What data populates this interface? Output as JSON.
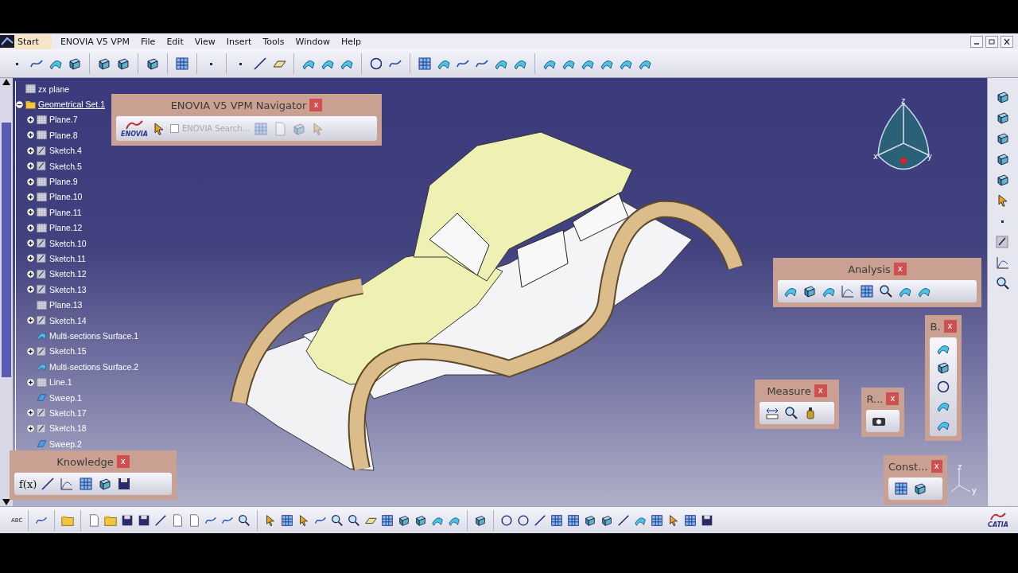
{
  "menu_bar": {
    "items": [
      {
        "label": "Start",
        "selected": true
      },
      {
        "label": "ENOVIA V5 VPM",
        "selected": false
      },
      {
        "label": "File",
        "selected": false
      },
      {
        "label": "Edit",
        "selected": false
      },
      {
        "label": "View",
        "selected": false
      },
      {
        "label": "Insert",
        "selected": false
      },
      {
        "label": "Tools",
        "selected": false
      },
      {
        "label": "Window",
        "selected": false
      },
      {
        "label": "Help",
        "selected": false
      }
    ]
  },
  "specification_tree": {
    "items": [
      {
        "label": "zx plane",
        "kind": "plane",
        "expandable": false
      },
      {
        "label": "Geometrical Set.1",
        "kind": "set",
        "expandable": true,
        "expanded": true,
        "children": [
          {
            "label": "Plane.7",
            "kind": "plane",
            "expandable": true,
            "expanded": false
          },
          {
            "label": "Plane.8",
            "kind": "plane",
            "expandable": true,
            "expanded": false
          },
          {
            "label": "Sketch.4",
            "kind": "sketch",
            "expandable": true,
            "expanded": false
          },
          {
            "label": "Sketch.5",
            "kind": "sketch",
            "expandable": true,
            "expanded": false
          },
          {
            "label": "Plane.9",
            "kind": "plane",
            "expandable": true,
            "expanded": false
          },
          {
            "label": "Plane.10",
            "kind": "plane",
            "expandable": true,
            "expanded": false
          },
          {
            "label": "Plane.11",
            "kind": "plane",
            "expandable": true,
            "expanded": false
          },
          {
            "label": "Plane.12",
            "kind": "plane",
            "expandable": true,
            "expanded": false
          },
          {
            "label": "Sketch.10",
            "kind": "sketch",
            "expandable": true,
            "expanded": false
          },
          {
            "label": "Sketch.11",
            "kind": "sketch",
            "expandable": true,
            "expanded": false
          },
          {
            "label": "Sketch.12",
            "kind": "sketch",
            "expandable": true,
            "expanded": false
          },
          {
            "label": "Sketch.13",
            "kind": "sketch",
            "expandable": true,
            "expanded": false
          },
          {
            "label": "Plane.13",
            "kind": "plane",
            "expandable": false
          },
          {
            "label": "Sketch.14",
            "kind": "sketch",
            "expandable": true,
            "expanded": false
          },
          {
            "label": "Multi-sections Surface.1",
            "kind": "surface",
            "expandable": false
          },
          {
            "label": "Sketch.15",
            "kind": "sketch",
            "expandable": true,
            "expanded": false
          },
          {
            "label": "Multi-sections Surface.2",
            "kind": "surface",
            "expandable": false
          },
          {
            "label": "Line.1",
            "kind": "plane",
            "expandable": true,
            "expanded": false
          },
          {
            "label": "Sweep.1",
            "kind": "sweep",
            "expandable": false
          },
          {
            "label": "Sketch.17",
            "kind": "sketch",
            "expandable": true,
            "expanded": false
          },
          {
            "label": "Sketch.18",
            "kind": "sketch",
            "expandable": true,
            "expanded": false
          },
          {
            "label": "Sweep.2",
            "kind": "sweep",
            "expandable": false
          }
        ]
      }
    ]
  },
  "floating_toolbars": [
    {
      "title": "ENOVIA V5 VPM Navigator",
      "close": "x",
      "kind": "enovia",
      "logo_text": "ENOVIA",
      "search": {
        "label": "ENOVIA Search...",
        "checked": false,
        "disabled": true
      }
    },
    {
      "title": "Knowledge",
      "close": "x",
      "kind": "knowledge",
      "formula_text": "f(x)"
    },
    {
      "title": "Analysis",
      "close": "x",
      "kind": "analysis"
    },
    {
      "title": "B.",
      "close": "x",
      "kind": "vertical"
    },
    {
      "title": "Measure",
      "close": "x",
      "kind": "measure"
    },
    {
      "title": "R...",
      "close": "x",
      "kind": "record"
    },
    {
      "title": "Const...",
      "close": "x",
      "kind": "constraint"
    }
  ],
  "compass": {
    "labels": [
      "z",
      "x",
      "y"
    ]
  },
  "axis_triad": {
    "labels": [
      "z",
      "y"
    ]
  },
  "bottom_toolbar": {
    "spell_icon_text": "ABC",
    "brand_text": "CATIA"
  }
}
